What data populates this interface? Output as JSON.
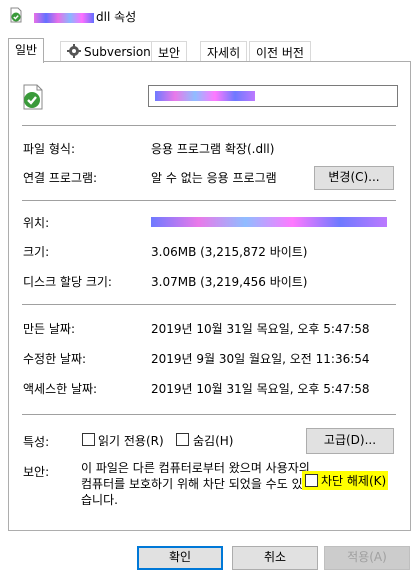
{
  "window": {
    "title_suffix": "dll 속성",
    "title_hidden": "redacted"
  },
  "tabs": [
    {
      "label": "일반",
      "active": true
    },
    {
      "label": "Subversion",
      "icon": "gear-icon"
    },
    {
      "label": "보안"
    },
    {
      "label": "자세히"
    },
    {
      "label": "이전 버전"
    }
  ],
  "general": {
    "file_icon": "green-check-file-icon",
    "file_type_label": "파일 형식:",
    "file_type_value": "응용 프로그램 확장(.dll)",
    "opens_with_label": "연결 프로그램:",
    "opens_with_value": "알 수 없는 응용 프로그램",
    "change_button": "변경(C)...",
    "location_label": "위치:",
    "size_label": "크기:",
    "size_value": "3.06MB (3,215,872 바이트)",
    "size_on_disk_label": "디스크 할당 크기:",
    "size_on_disk_value": "3.07MB (3,219,456 바이트)",
    "created_label": "만든 날짜:",
    "created_value": "2019년 10월 31일 목요일, 오후 5:47:58",
    "modified_label": "수정한 날짜:",
    "modified_value": "2019년 9월 30일 월요일, 오전 11:36:54",
    "accessed_label": "액세스한 날짜:",
    "accessed_value": "2019년 10월 31일 목요일, 오후 5:47:58",
    "attributes_label": "특성:",
    "readonly_label": "읽기 전용(R)",
    "hidden_label": "숨김(H)",
    "advanced_button": "고급(D)...",
    "security_label": "보안:",
    "security_text": "이 파일은 다른 컴퓨터로부터 왔으며 사용자의 컴퓨터를 보호하기 위해 차단 되었을 수도 있습니다.",
    "unblock_label": "차단 해제(K)"
  },
  "footer": {
    "ok": "확인",
    "cancel": "취소",
    "apply": "적용(A)"
  },
  "colors": {
    "accent": "#0078d7",
    "highlight": "#ffff00",
    "icon_green": "#3a9a3a"
  }
}
